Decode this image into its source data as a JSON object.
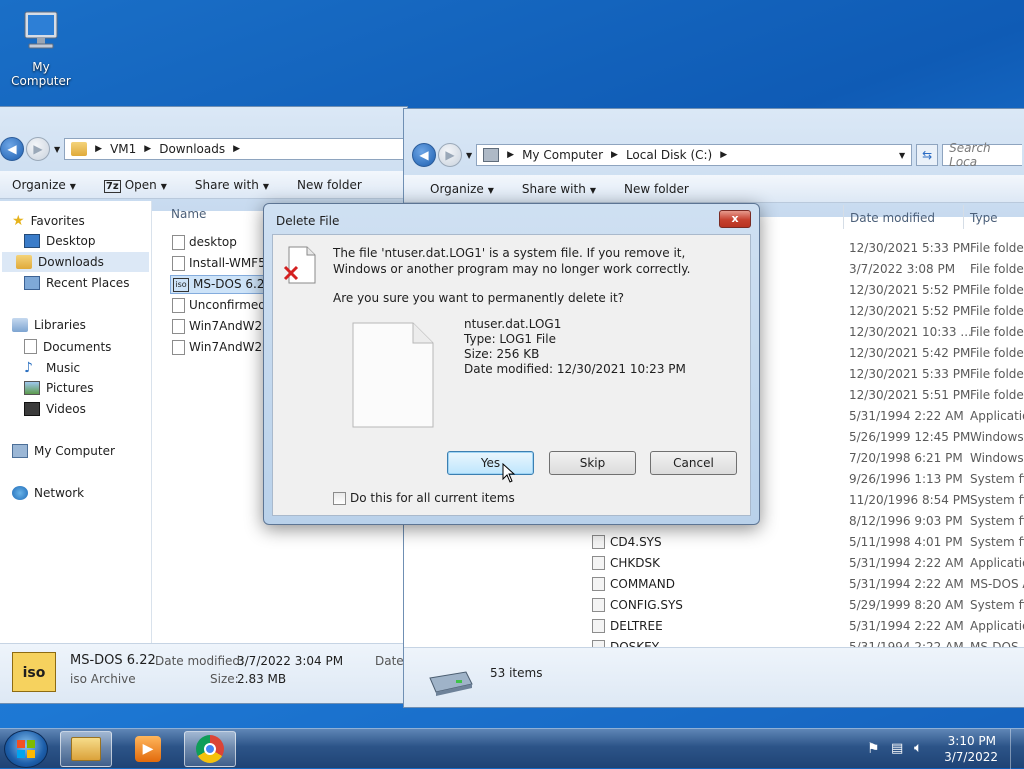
{
  "desktop": {
    "icon_label": "My Computer"
  },
  "left_window": {
    "breadcrumb": [
      "VM1",
      "Downloads"
    ],
    "commands": {
      "organize": "Organize",
      "open": "Open",
      "share_with": "Share with",
      "new_folder": "New folder"
    },
    "nav": {
      "favorites": "Favorites",
      "desktop": "Desktop",
      "downloads": "Downloads",
      "recent_places": "Recent Places",
      "libraries": "Libraries",
      "documents": "Documents",
      "music": "Music",
      "pictures": "Pictures",
      "videos": "Videos",
      "my_computer": "My Computer",
      "network": "Network"
    },
    "column_name": "Name",
    "files": [
      "desktop",
      "Install-WMF5.",
      "MS-DOS 6.22",
      "Unconfirmed",
      "Win7AndW2K",
      "Win7AndW2K"
    ],
    "details": {
      "name": "MS-DOS 6.22",
      "type": "iso Archive",
      "date_label": "Date modified:",
      "date_value": "3/7/2022 3:04 PM",
      "size_label": "Size:",
      "size_value": "2.83 MB",
      "date_trunc": "Date"
    }
  },
  "right_window": {
    "breadcrumb": [
      "My Computer",
      "Local Disk (C:)"
    ],
    "search_placeholder": "Search Loca",
    "commands": {
      "organize": "Organize",
      "share_with": "Share with",
      "new_folder": "New folder"
    },
    "columns": {
      "date": "Date modified",
      "type": "Type"
    },
    "rows": [
      {
        "name": "",
        "date": "12/30/2021 5:33 PM",
        "type": "File folder"
      },
      {
        "name": "",
        "date": "3/7/2022 3:08 PM",
        "type": "File folder"
      },
      {
        "name": "",
        "date": "12/30/2021 5:52 PM",
        "type": "File folder"
      },
      {
        "name": "",
        "date": "12/30/2021 5:52 PM",
        "type": "File folder"
      },
      {
        "name": "",
        "date": "12/30/2021 10:33 ...",
        "type": "File folder"
      },
      {
        "name": "",
        "date": "12/30/2021 5:42 PM",
        "type": "File folder"
      },
      {
        "name": "",
        "date": "12/30/2021 5:33 PM",
        "type": "File folder"
      },
      {
        "name": "",
        "date": "12/30/2021 5:51 PM",
        "type": "File folder"
      },
      {
        "name": "",
        "date": "5/31/1994 2:22 AM",
        "type": "Application"
      },
      {
        "name": "",
        "date": "5/26/1999 12:45 PM",
        "type": "Windows B"
      },
      {
        "name": "",
        "date": "7/20/1998 6:21 PM",
        "type": "Windows B"
      },
      {
        "name": "",
        "date": "9/26/1996 1:13 PM",
        "type": "System file"
      },
      {
        "name": "",
        "date": "11/20/1996 8:54 PM",
        "type": "System file"
      },
      {
        "name": "",
        "date": "8/12/1996 9:03 PM",
        "type": "System file"
      },
      {
        "name": "CD4.SYS",
        "date": "5/11/1998 4:01 PM",
        "type": "System file"
      },
      {
        "name": "CHKDSK",
        "date": "5/31/1994 2:22 AM",
        "type": "Application"
      },
      {
        "name": "COMMAND",
        "date": "5/31/1994 2:22 AM",
        "type": "MS-DOS A"
      },
      {
        "name": "CONFIG.SYS",
        "date": "5/29/1999 8:20 AM",
        "type": "System file"
      },
      {
        "name": "DELTREE",
        "date": "5/31/1994 2:22 AM",
        "type": "Application"
      },
      {
        "name": "DOSKEY",
        "date": "5/31/1994 2:22 AM",
        "type": "MS-DOS A"
      }
    ],
    "status": "53 items"
  },
  "dialog": {
    "title": "Delete File",
    "close": "x",
    "message": "The file 'ntuser.dat.LOG1' is a system file. If you remove it, Windows or another program may no longer work correctly.",
    "question": "Are you sure you want to permanently delete it?",
    "file_name": "ntuser.dat.LOG1",
    "file_type": "Type: LOG1 File",
    "file_size": "Size: 256 KB",
    "file_date": "Date modified: 12/30/2021 10:23 PM",
    "buttons": {
      "yes": "Yes",
      "skip": "Skip",
      "cancel": "Cancel"
    },
    "checkbox_label": "Do this for all current items"
  },
  "taskbar": {
    "time": "3:10 PM",
    "date": "3/7/2022"
  }
}
